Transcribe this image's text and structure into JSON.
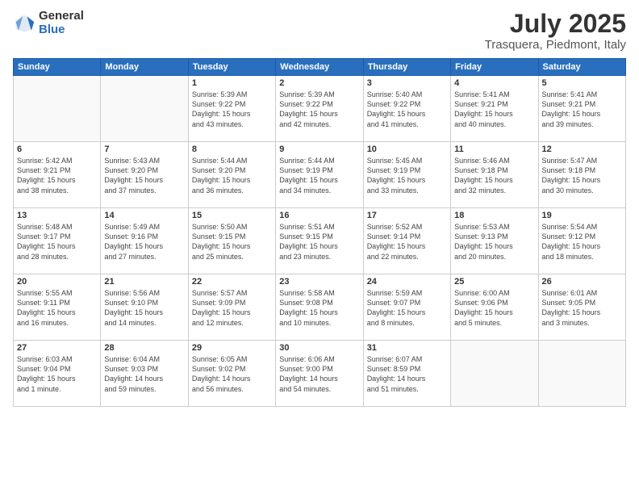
{
  "header": {
    "logo_general": "General",
    "logo_blue": "Blue",
    "month": "July 2025",
    "location": "Trasquera, Piedmont, Italy"
  },
  "weekdays": [
    "Sunday",
    "Monday",
    "Tuesday",
    "Wednesday",
    "Thursday",
    "Friday",
    "Saturday"
  ],
  "weeks": [
    [
      {
        "day": "",
        "content": ""
      },
      {
        "day": "",
        "content": ""
      },
      {
        "day": "1",
        "content": "Sunrise: 5:39 AM\nSunset: 9:22 PM\nDaylight: 15 hours\nand 43 minutes."
      },
      {
        "day": "2",
        "content": "Sunrise: 5:39 AM\nSunset: 9:22 PM\nDaylight: 15 hours\nand 42 minutes."
      },
      {
        "day": "3",
        "content": "Sunrise: 5:40 AM\nSunset: 9:22 PM\nDaylight: 15 hours\nand 41 minutes."
      },
      {
        "day": "4",
        "content": "Sunrise: 5:41 AM\nSunset: 9:21 PM\nDaylight: 15 hours\nand 40 minutes."
      },
      {
        "day": "5",
        "content": "Sunrise: 5:41 AM\nSunset: 9:21 PM\nDaylight: 15 hours\nand 39 minutes."
      }
    ],
    [
      {
        "day": "6",
        "content": "Sunrise: 5:42 AM\nSunset: 9:21 PM\nDaylight: 15 hours\nand 38 minutes."
      },
      {
        "day": "7",
        "content": "Sunrise: 5:43 AM\nSunset: 9:20 PM\nDaylight: 15 hours\nand 37 minutes."
      },
      {
        "day": "8",
        "content": "Sunrise: 5:44 AM\nSunset: 9:20 PM\nDaylight: 15 hours\nand 36 minutes."
      },
      {
        "day": "9",
        "content": "Sunrise: 5:44 AM\nSunset: 9:19 PM\nDaylight: 15 hours\nand 34 minutes."
      },
      {
        "day": "10",
        "content": "Sunrise: 5:45 AM\nSunset: 9:19 PM\nDaylight: 15 hours\nand 33 minutes."
      },
      {
        "day": "11",
        "content": "Sunrise: 5:46 AM\nSunset: 9:18 PM\nDaylight: 15 hours\nand 32 minutes."
      },
      {
        "day": "12",
        "content": "Sunrise: 5:47 AM\nSunset: 9:18 PM\nDaylight: 15 hours\nand 30 minutes."
      }
    ],
    [
      {
        "day": "13",
        "content": "Sunrise: 5:48 AM\nSunset: 9:17 PM\nDaylight: 15 hours\nand 28 minutes."
      },
      {
        "day": "14",
        "content": "Sunrise: 5:49 AM\nSunset: 9:16 PM\nDaylight: 15 hours\nand 27 minutes."
      },
      {
        "day": "15",
        "content": "Sunrise: 5:50 AM\nSunset: 9:15 PM\nDaylight: 15 hours\nand 25 minutes."
      },
      {
        "day": "16",
        "content": "Sunrise: 5:51 AM\nSunset: 9:15 PM\nDaylight: 15 hours\nand 23 minutes."
      },
      {
        "day": "17",
        "content": "Sunrise: 5:52 AM\nSunset: 9:14 PM\nDaylight: 15 hours\nand 22 minutes."
      },
      {
        "day": "18",
        "content": "Sunrise: 5:53 AM\nSunset: 9:13 PM\nDaylight: 15 hours\nand 20 minutes."
      },
      {
        "day": "19",
        "content": "Sunrise: 5:54 AM\nSunset: 9:12 PM\nDaylight: 15 hours\nand 18 minutes."
      }
    ],
    [
      {
        "day": "20",
        "content": "Sunrise: 5:55 AM\nSunset: 9:11 PM\nDaylight: 15 hours\nand 16 minutes."
      },
      {
        "day": "21",
        "content": "Sunrise: 5:56 AM\nSunset: 9:10 PM\nDaylight: 15 hours\nand 14 minutes."
      },
      {
        "day": "22",
        "content": "Sunrise: 5:57 AM\nSunset: 9:09 PM\nDaylight: 15 hours\nand 12 minutes."
      },
      {
        "day": "23",
        "content": "Sunrise: 5:58 AM\nSunset: 9:08 PM\nDaylight: 15 hours\nand 10 minutes."
      },
      {
        "day": "24",
        "content": "Sunrise: 5:59 AM\nSunset: 9:07 PM\nDaylight: 15 hours\nand 8 minutes."
      },
      {
        "day": "25",
        "content": "Sunrise: 6:00 AM\nSunset: 9:06 PM\nDaylight: 15 hours\nand 5 minutes."
      },
      {
        "day": "26",
        "content": "Sunrise: 6:01 AM\nSunset: 9:05 PM\nDaylight: 15 hours\nand 3 minutes."
      }
    ],
    [
      {
        "day": "27",
        "content": "Sunrise: 6:03 AM\nSunset: 9:04 PM\nDaylight: 15 hours\nand 1 minute."
      },
      {
        "day": "28",
        "content": "Sunrise: 6:04 AM\nSunset: 9:03 PM\nDaylight: 14 hours\nand 59 minutes."
      },
      {
        "day": "29",
        "content": "Sunrise: 6:05 AM\nSunset: 9:02 PM\nDaylight: 14 hours\nand 56 minutes."
      },
      {
        "day": "30",
        "content": "Sunrise: 6:06 AM\nSunset: 9:00 PM\nDaylight: 14 hours\nand 54 minutes."
      },
      {
        "day": "31",
        "content": "Sunrise: 6:07 AM\nSunset: 8:59 PM\nDaylight: 14 hours\nand 51 minutes."
      },
      {
        "day": "",
        "content": ""
      },
      {
        "day": "",
        "content": ""
      }
    ]
  ]
}
